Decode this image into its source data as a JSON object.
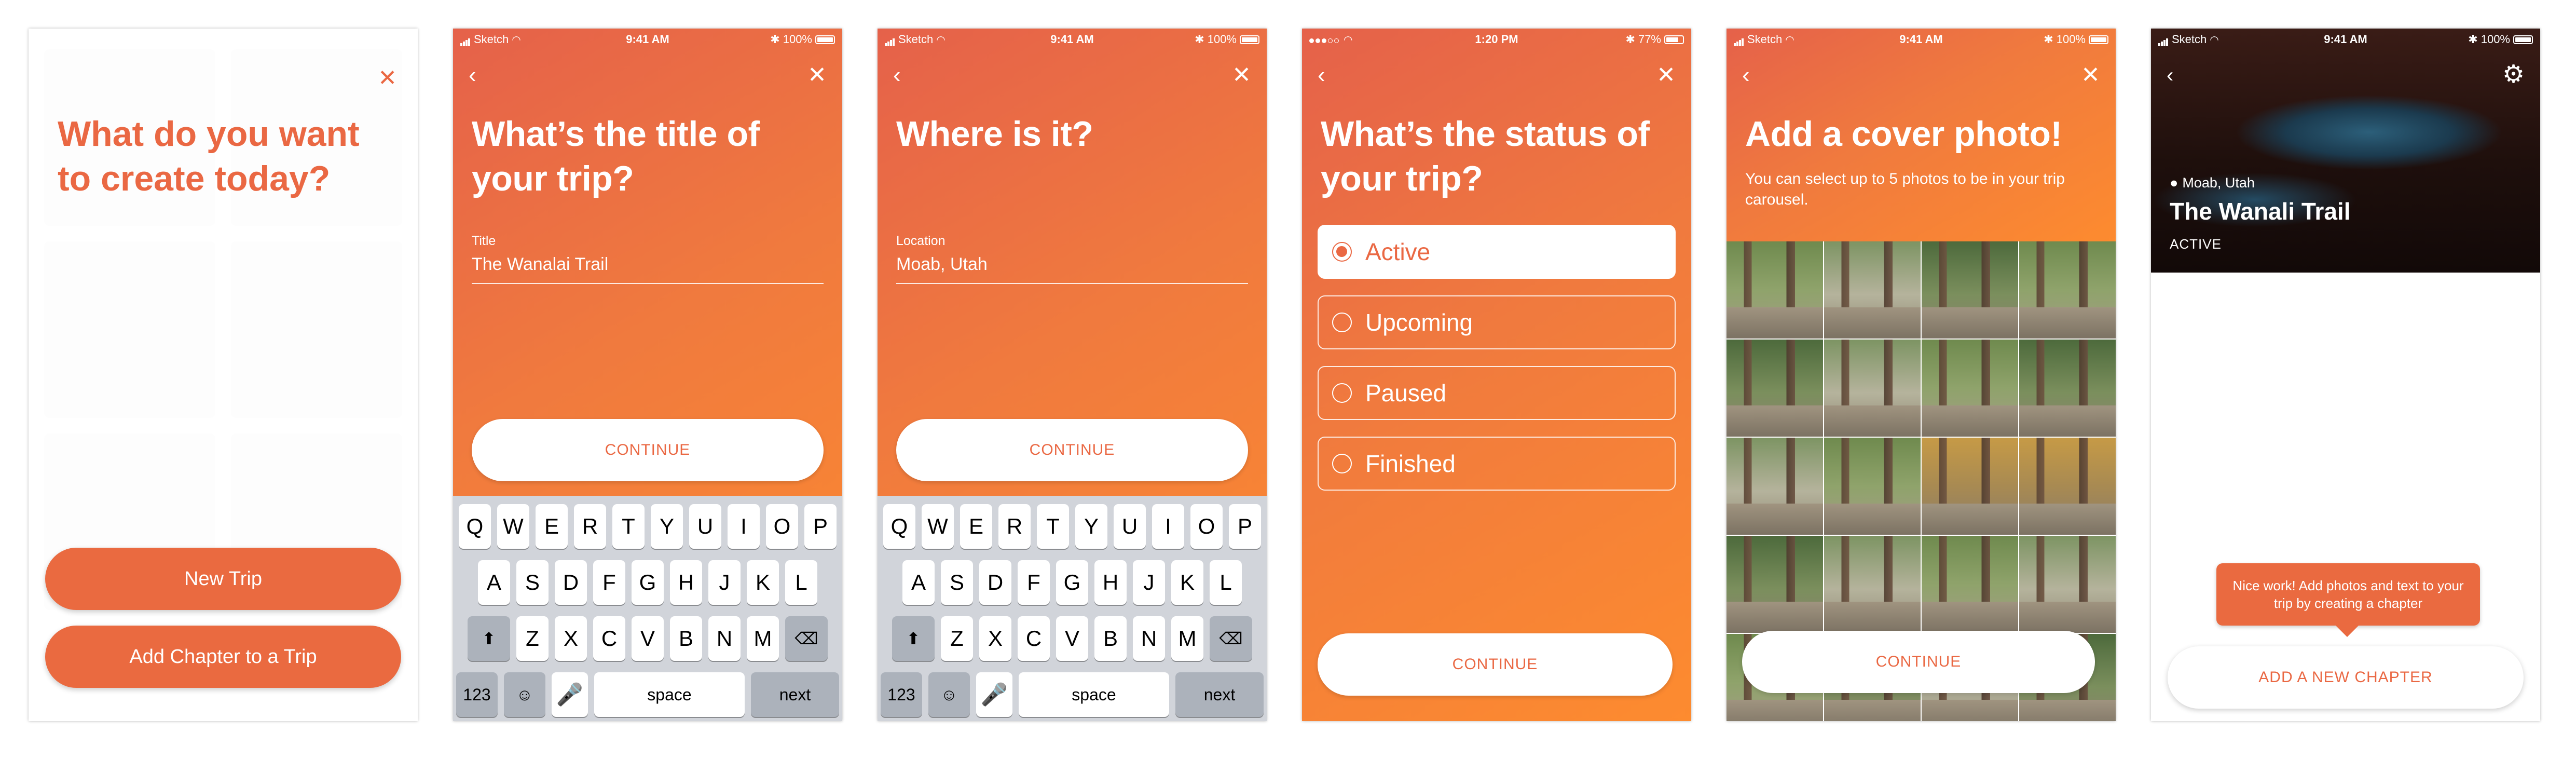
{
  "status_bar": {
    "carrier": "Sketch",
    "time": "9:41 AM",
    "battery": "100%",
    "time_alt": "1:20 PM",
    "battery_alt": "77%"
  },
  "screen1": {
    "title": "What do you want to create today?",
    "primary_button": "New Trip",
    "secondary_button": "Add Chapter to a Trip"
  },
  "screen2": {
    "title": "What’s the title of your trip?",
    "field_label": "Title",
    "field_value": "The Wanalai Trail",
    "continue_label": "CONTINUE"
  },
  "screen3": {
    "title": "Where is it?",
    "field_label": "Location",
    "field_value": "Moab, Utah",
    "continue_label": "CONTINUE"
  },
  "keyboard": {
    "row1": [
      "Q",
      "W",
      "E",
      "R",
      "T",
      "Y",
      "U",
      "I",
      "O",
      "P"
    ],
    "row2": [
      "A",
      "S",
      "D",
      "F",
      "G",
      "H",
      "J",
      "K",
      "L"
    ],
    "row3": [
      "Z",
      "X",
      "C",
      "V",
      "B",
      "N",
      "M"
    ],
    "numbers_key": "123",
    "space_key": "space",
    "return_key": "next"
  },
  "screen4": {
    "title": "What’s the status of your trip?",
    "options": [
      "Active",
      "Upcoming",
      "Paused",
      "Finished"
    ],
    "selected": "Active",
    "continue_label": "CONTINUE"
  },
  "screen5": {
    "title": "Add a cover photo!",
    "subtitle": "You can select up to 5 photos to be in your trip carousel.",
    "continue_label": "CONTINUE"
  },
  "screen6": {
    "location": "Moab, Utah",
    "trip_title": "The Wanali Trail",
    "trip_status": "ACTIVE",
    "tooltip": "Nice work!  Add photos and text to your trip by  creating a chapter",
    "add_chapter_label": "ADD A NEW CHAPTER"
  },
  "colors": {
    "accent": "#ea6843",
    "gradient_start": "#e5614a",
    "gradient_end": "#fd8b2f"
  }
}
